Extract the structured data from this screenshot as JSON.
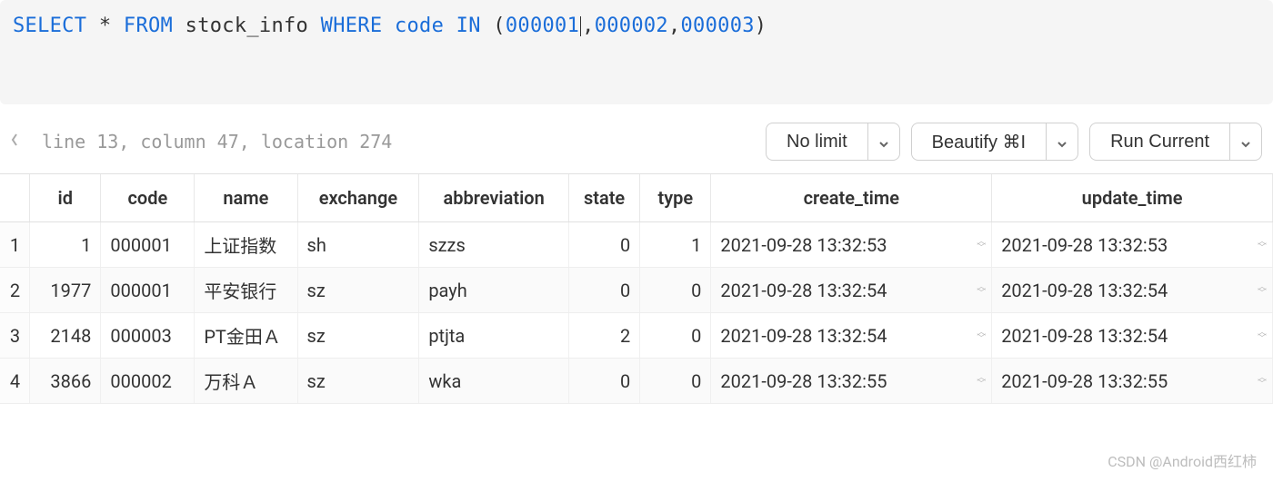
{
  "sql": {
    "tokens": [
      {
        "t": "SELECT",
        "c": "kw"
      },
      {
        "t": " "
      },
      {
        "t": "*",
        "c": ""
      },
      {
        "t": " "
      },
      {
        "t": "FROM",
        "c": "kw"
      },
      {
        "t": " "
      },
      {
        "t": "stock_info",
        "c": ""
      },
      {
        "t": " "
      },
      {
        "t": "WHERE",
        "c": "kw"
      },
      {
        "t": " "
      },
      {
        "t": "code",
        "c": "kw"
      },
      {
        "t": " "
      },
      {
        "t": "IN",
        "c": "kw"
      },
      {
        "t": " ("
      },
      {
        "t": "000001",
        "c": "num"
      },
      {
        "t": "|",
        "c": "cursor"
      },
      {
        "t": ","
      },
      {
        "t": "000002",
        "c": "num"
      },
      {
        "t": ","
      },
      {
        "t": "000003",
        "c": "num"
      },
      {
        "t": ")"
      }
    ]
  },
  "status": {
    "line_col_loc": "line 13, column 47, location 274"
  },
  "toolbar": {
    "limit_label": "No limit",
    "beautify_label": "Beautify ⌘I",
    "run_label": "Run Current"
  },
  "columns": [
    "id",
    "code",
    "name",
    "exchange",
    "abbreviation",
    "state",
    "type",
    "create_time",
    "update_time"
  ],
  "rows": [
    {
      "rownum": "1",
      "id": "1",
      "code": "000001",
      "name": "上证指数",
      "exchange": "sh",
      "abbreviation": "szzs",
      "state": "0",
      "type": "1",
      "create_time": "2021-09-28 13:32:53",
      "update_time": "2021-09-28 13:32:53"
    },
    {
      "rownum": "2",
      "id": "1977",
      "code": "000001",
      "name": "平安银行",
      "exchange": "sz",
      "abbreviation": "payh",
      "state": "0",
      "type": "0",
      "create_time": "2021-09-28 13:32:54",
      "update_time": "2021-09-28 13:32:54"
    },
    {
      "rownum": "3",
      "id": "2148",
      "code": "000003",
      "name": "PT金田Ａ",
      "exchange": "sz",
      "abbreviation": "ptjta",
      "state": "2",
      "type": "0",
      "create_time": "2021-09-28 13:32:54",
      "update_time": "2021-09-28 13:32:54"
    },
    {
      "rownum": "4",
      "id": "3866",
      "code": "000002",
      "name": "万科Ａ",
      "exchange": "sz",
      "abbreviation": "wka",
      "state": "0",
      "type": "0",
      "create_time": "2021-09-28 13:32:55",
      "update_time": "2021-09-28 13:32:55"
    }
  ],
  "watermark": "CSDN @Android西红柿"
}
